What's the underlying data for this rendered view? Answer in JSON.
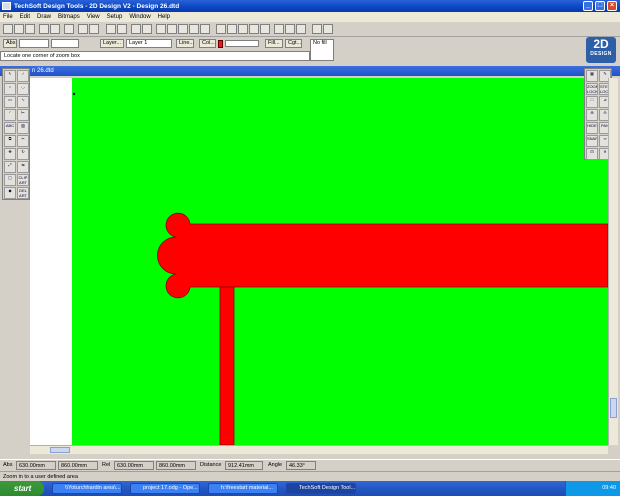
{
  "window": {
    "title": "TechSoft Design Tools - 2D Design V2 - Design 26.dtd",
    "doc_title": "n 26.dtd"
  },
  "menu": [
    "File",
    "Edit",
    "Draw",
    "Bitmaps",
    "View",
    "Setup",
    "Window",
    "Help"
  ],
  "propbar": {
    "abs_label": "Abs",
    "layer_label": "Layer...",
    "layer_value": "Layer 1",
    "line_label": "Line...",
    "col_label": "Col...",
    "fill_label": "Fill...",
    "cgt_label": "Cgt...",
    "no_fill": "No fill"
  },
  "hint": "Locate one corner of zoom box",
  "logo": {
    "big": "2D",
    "small": "DESIGN"
  },
  "left_tools": [
    "ABC",
    "CLIP ART",
    "DEL ART"
  ],
  "right_tools": [
    "ZOOM LOCK",
    "STEP LOCK",
    "HIDE",
    "PAN",
    "SNAP"
  ],
  "status": {
    "abs_label": "Abs",
    "abs_x": "630.00mm",
    "abs_y": "860.00mm",
    "rel_label": "Rel",
    "rel_x": "630.00mm",
    "rel_y": "860.00mm",
    "distance_label": "Distance",
    "distance_value": "912.41mm",
    "angle_label": "Angle",
    "angle_value": "46.33°"
  },
  "zoom_status": "Zoom in to a user defined area",
  "taskbar": {
    "start": "start",
    "tasks": [
      "\\\\Yoturchhardin area\\...",
      "project 17.odg - Ope...",
      "h:\\freestart material...",
      "TechSoft Design Tool..."
    ],
    "clock": "09:40"
  },
  "colors": {
    "canvas": "#00ff00",
    "shape": "#ff0000",
    "outline": "#8b0000"
  }
}
